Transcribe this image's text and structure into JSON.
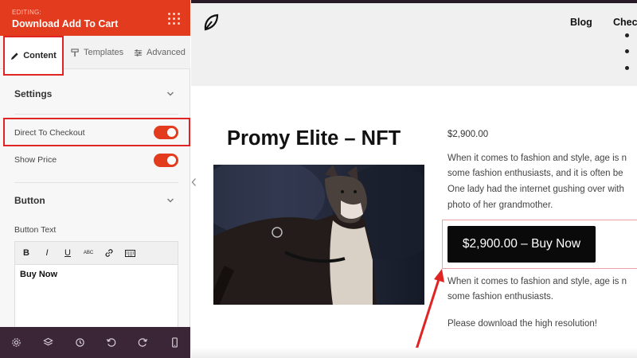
{
  "panel": {
    "editing_label": "EDITING:",
    "title": "Download Add To Cart",
    "tabs": [
      {
        "label": "Content",
        "icon": "pencil-icon"
      },
      {
        "label": "Templates",
        "icon": "paint-roller-icon"
      },
      {
        "label": "Advanced",
        "icon": "sliders-icon"
      }
    ],
    "settings_title": "Settings",
    "direct_to_checkout_label": "Direct To Checkout",
    "direct_to_checkout": true,
    "show_price_label": "Show Price",
    "show_price": true,
    "button_title": "Button",
    "button_text_label": "Button Text",
    "toolbar": {
      "bold": "B",
      "italic": "I",
      "underline": "U",
      "abc": "ABC"
    },
    "button_text_value": "Buy Now",
    "bottom_icons": [
      "gear-icon",
      "layers-icon",
      "history-icon",
      "undo-icon",
      "redo-icon",
      "mobile-icon"
    ],
    "accent": "#e23b1d"
  },
  "site": {
    "nav": [
      "Blog",
      "Checkout"
    ],
    "product_title": "Promy Elite – NFT",
    "price": "$2,900.00",
    "description_lines": [
      "When it comes to fashion and style, age is n",
      "some fashion enthusiasts, and it is often be",
      "One lady had the internet gushing over with",
      "photo of her grandmother."
    ],
    "buy_button": "$2,900.00 – Buy Now",
    "description2_lines": [
      "When it comes to fashion and style, age is n",
      "some fashion enthusiasts."
    ],
    "download_note": "Please download the high resolution!",
    "image_subject": "dog-photo"
  }
}
